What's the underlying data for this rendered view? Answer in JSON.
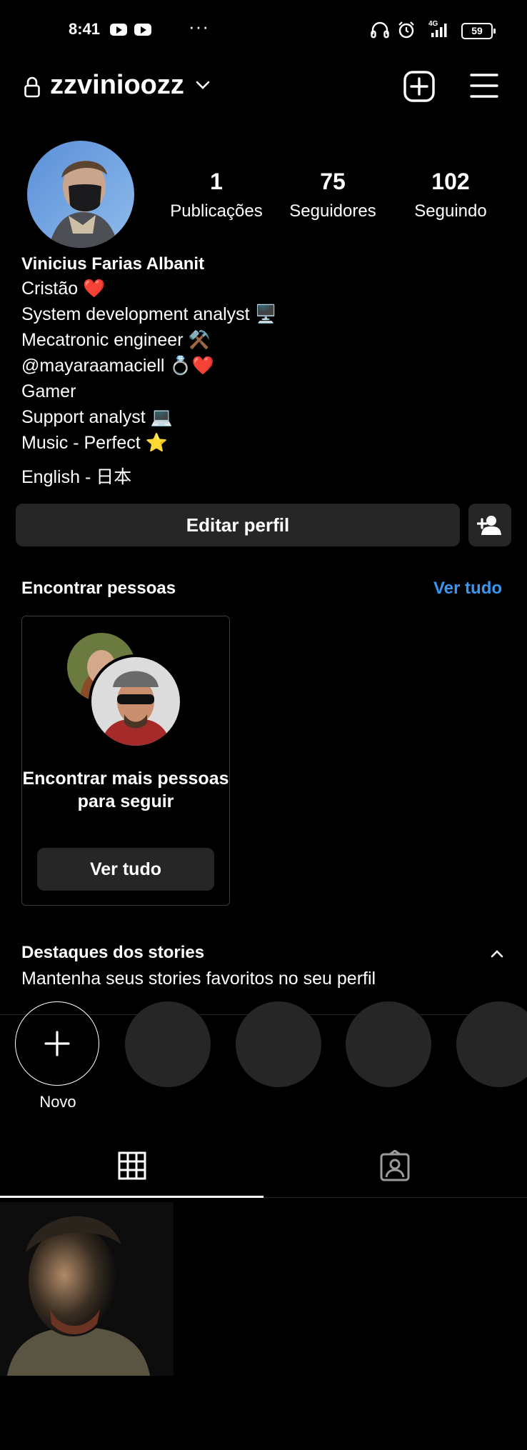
{
  "status_bar": {
    "time": "8:41",
    "more": "···",
    "network": "4G",
    "battery": "59",
    "icons": [
      "youtube-icon",
      "youtube-icon",
      "headphones-icon",
      "alarm-icon",
      "signal-icon",
      "battery-icon"
    ]
  },
  "header": {
    "username": "zzvinioozz",
    "icons": [
      "lock-icon",
      "chevron-down-icon",
      "new-post-icon",
      "menu-icon"
    ]
  },
  "stats": [
    {
      "value": "1",
      "label": "Publicações"
    },
    {
      "value": "75",
      "label": "Seguidores"
    },
    {
      "value": "102",
      "label": "Seguindo"
    }
  ],
  "bio": {
    "name": "Vinicius Farias Albanit",
    "lines": [
      "Cristão ❤️",
      "System development analyst 🖥️",
      "Mecatronic engineer ⚒️",
      "@mayaraamaciell 💍❤️",
      "Gamer",
      "Support analyst 💻",
      "Music - Perfect ⭐",
      "English - 日本"
    ]
  },
  "actions": {
    "edit_profile": "Editar perfil",
    "add_person_icon": "add-person-icon"
  },
  "discover": {
    "title": "Encontrar pessoas",
    "see_all": "Ver tudo",
    "card_text": "Encontrar mais pessoas para seguir",
    "card_button": "Ver tudo"
  },
  "highlights": {
    "title": "Destaques dos stories",
    "subtitle": "Mantenha seus stories favoritos no seu perfil",
    "new_label": "Novo",
    "collapse_icon": "chevron-up-icon"
  },
  "tabs": [
    {
      "icon": "grid-icon",
      "active": true
    },
    {
      "icon": "tagged-icon",
      "active": false
    }
  ],
  "colors": {
    "background": "#000000",
    "surface": "#262626",
    "accent": "#3897f0",
    "text": "#ffffff"
  }
}
